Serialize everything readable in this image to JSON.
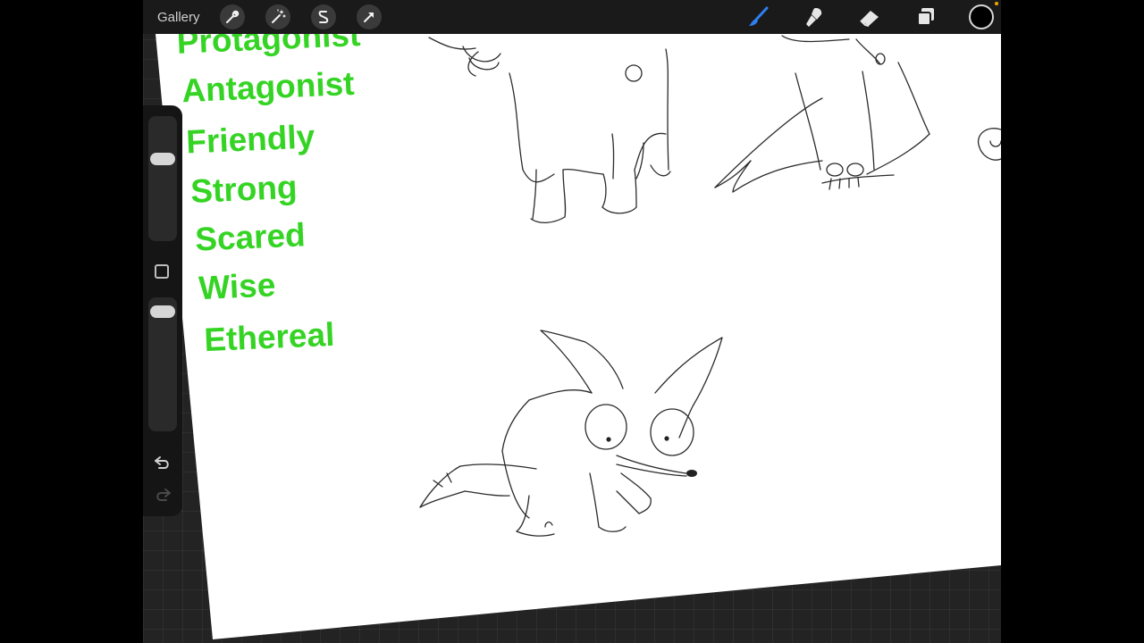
{
  "toolbar": {
    "gallery_label": "Gallery",
    "left_tools": [
      "wrench-icon",
      "magic-wand-icon",
      "selection-icon",
      "transform-arrow-icon"
    ],
    "right_tools": [
      "brush-icon",
      "smudge-icon",
      "eraser-icon",
      "layers-icon"
    ],
    "active_tool": "brush-icon",
    "current_color": "#000000",
    "accent_color": "#2f7ff2"
  },
  "canvas": {
    "text_color": "#35d424",
    "words": [
      "Protagonist",
      "Antagonist",
      "Friendly",
      "Strong",
      "Scared",
      "Wise",
      "Ethereal"
    ]
  },
  "sidebar": {
    "icons": [
      "undo-icon",
      "redo-icon",
      "modify-square-icon"
    ]
  }
}
